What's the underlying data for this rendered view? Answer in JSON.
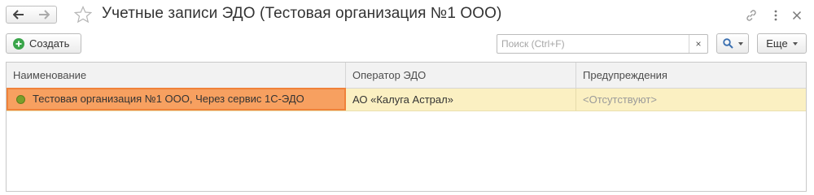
{
  "window": {
    "title": "Учетные записи ЭДО (Тестовая организация №1 ООО)"
  },
  "toolbar": {
    "create_label": "Создать",
    "search_placeholder": "Поиск (Ctrl+F)",
    "search_value": "",
    "clear_label": "×",
    "more_label": "Еще"
  },
  "table": {
    "columns": [
      "Наименование",
      "Оператор ЭДО",
      "Предупреждения"
    ],
    "rows": [
      {
        "name": "Тестовая организация №1 ООО, Через сервис 1С-ЭДО",
        "operator": "АО «Калуга Астрал»",
        "warnings": "<Отсутствуют>",
        "status": "active",
        "selected": true
      }
    ]
  },
  "icons": {
    "back": "arrow-left-icon",
    "forward": "arrow-right-icon",
    "favorite": "star-icon",
    "link": "link-icon",
    "more": "more-vertical-icon",
    "close": "close-icon",
    "create": "plus-circle-icon",
    "search": "magnifier-icon"
  },
  "colors": {
    "selected_row": "#fbf0c2",
    "selected_cell": "#f7a060",
    "create_icon": "#3aa54a",
    "status_dot": "#7a9e2a",
    "search_accent": "#3a6fb0"
  }
}
